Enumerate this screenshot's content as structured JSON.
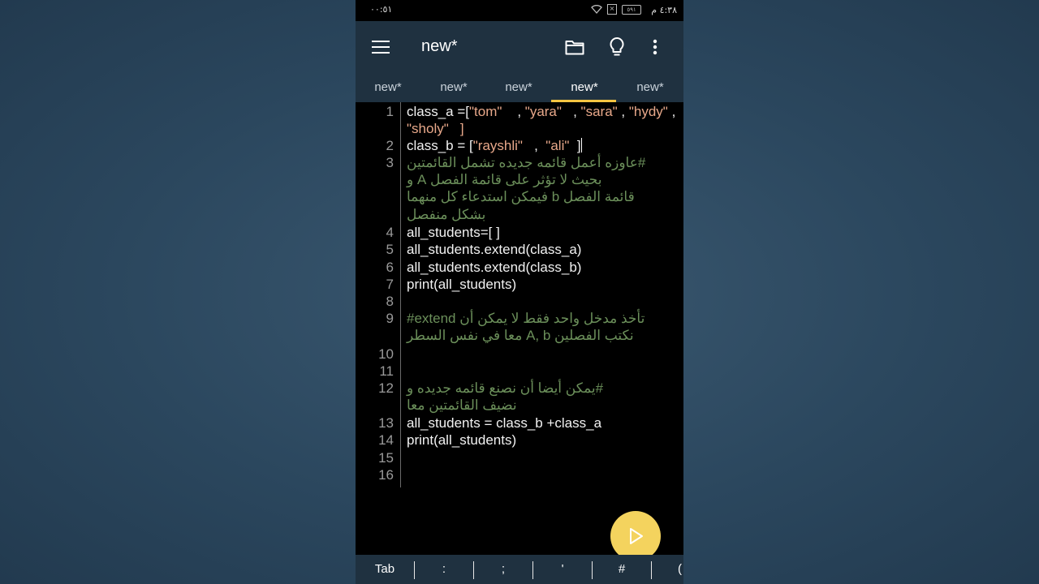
{
  "status_bar": {
    "time_left": "٠٠:٥١",
    "time_right": "٤:٣٨ م",
    "battery": "٥٩١"
  },
  "app_bar": {
    "title": "new*",
    "icons": [
      "menu-icon",
      "folder-icon",
      "lightbulb-icon",
      "more-vert-icon"
    ]
  },
  "tabs": [
    {
      "label": "new*"
    },
    {
      "label": "new*"
    },
    {
      "label": "new*"
    },
    {
      "label": "new*",
      "active": true
    },
    {
      "label": "new*"
    }
  ],
  "editor": {
    "lines": [
      {
        "num": "1",
        "code": "class_a =[",
        "strings": [
          "\"tom\"",
          "\"yara\"",
          "\"sara\"",
          "\"hydy\""
        ],
        "cont": "\"sholy\"   ]"
      },
      {
        "num": "2",
        "code": "class_b = [",
        "strings": [
          "\"rayshli\"",
          "\"ali\""
        ]
      },
      {
        "num": "3",
        "comment": [
          "#عاوزه أعمل قائمه جديده تشمل القائمتين",
          "بحيث لا تؤثر على قائمة الفصل A و",
          "قائمة الفصل b فيمكن استدعاء كل منهما",
          "بشكل منفصل"
        ]
      },
      {
        "num": "4",
        "code": "all_students=[ ]"
      },
      {
        "num": "5",
        "code": "all_students.extend(class_a)"
      },
      {
        "num": "6",
        "code": "all_students.extend(class_b)"
      },
      {
        "num": "7",
        "code": "print(all_students)"
      },
      {
        "num": "8",
        "code": ""
      },
      {
        "num": "9",
        "comment": [
          "#extend تأخذ مدخل واحد فقط لا يمكن أن",
          "نكتب الفصلين A, b معا في نفس السطر"
        ]
      },
      {
        "num": "10",
        "code": ""
      },
      {
        "num": "11",
        "code": ""
      },
      {
        "num": "12",
        "comment": [
          "#يمكن أيضا أن نصنع قائمه جديده و",
          "نضيف القائمتين معا"
        ]
      },
      {
        "num": "13",
        "code": "all_students = class_b +class_a"
      },
      {
        "num": "14",
        "code": "print(all_students)"
      },
      {
        "num": "15",
        "code": ""
      },
      {
        "num": "16",
        "code": ""
      }
    ]
  },
  "keybar": {
    "keys": [
      "Tab",
      ":",
      ";",
      "'",
      "#",
      "("
    ]
  },
  "colors": {
    "appbar": "#1f3140",
    "accent": "#f5c542",
    "string": "#e8a88a",
    "comment": "#6b8f5a",
    "run_button": "#f4d35e"
  }
}
